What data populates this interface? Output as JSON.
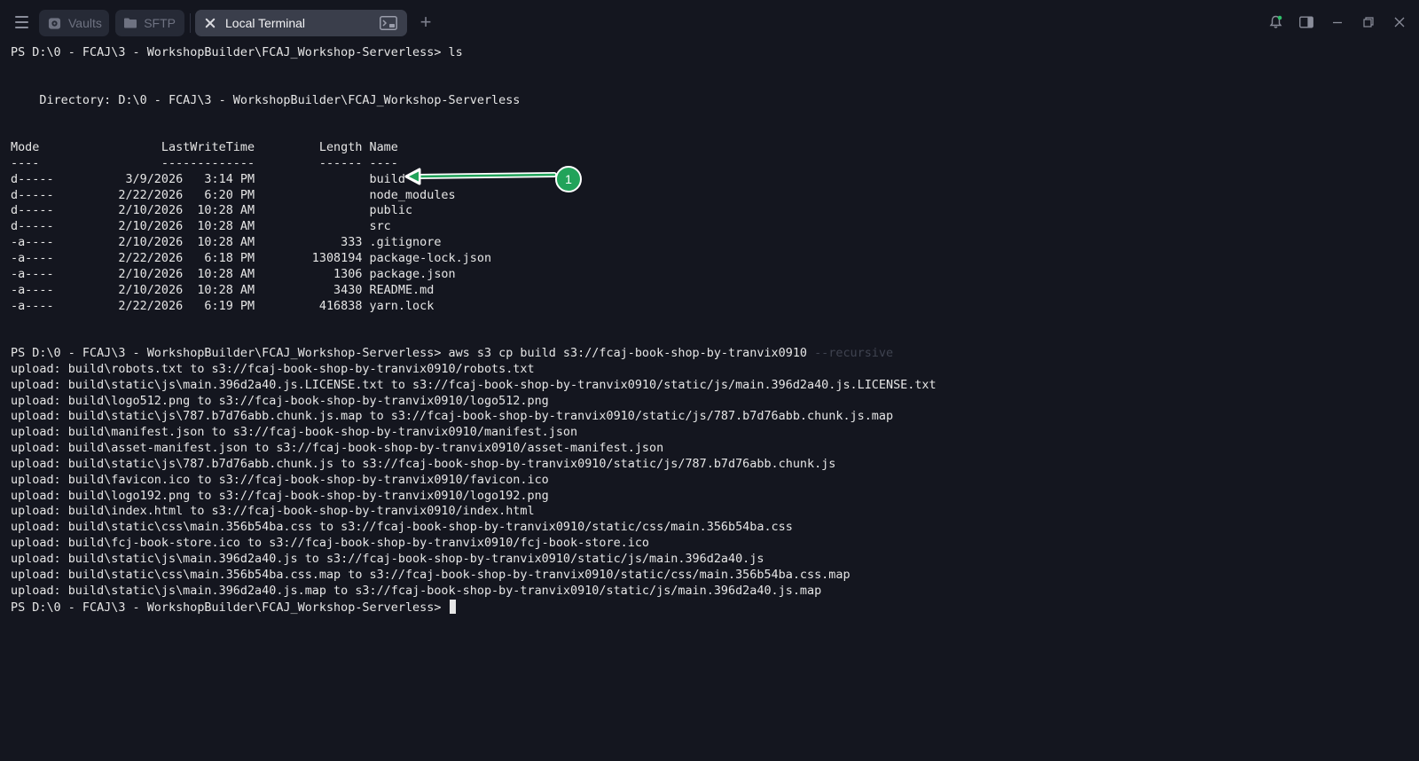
{
  "titlebar": {
    "tabs": [
      {
        "label": "Vaults",
        "icon": "vault-icon",
        "active": false
      },
      {
        "label": "SFTP",
        "icon": "folder-icon",
        "active": false
      },
      {
        "label": "Local Terminal",
        "icon": "close-icon",
        "active": true
      }
    ],
    "add_tab_label": "+",
    "window_icons": [
      "notification-bell-icon",
      "sidebar-panel-icon",
      "minimize-icon",
      "restore-icon",
      "close-icon"
    ]
  },
  "terminal": {
    "lines": [
      "PS D:\\0 - FCAJ\\3 - WorkshopBuilder\\FCAJ_Workshop-Serverless> ls",
      "",
      "",
      "    Directory: D:\\0 - FCAJ\\3 - WorkshopBuilder\\FCAJ_Workshop-Serverless",
      "",
      "",
      "Mode                 LastWriteTime         Length Name",
      "----                 -------------         ------ ----",
      "d-----          3/9/2026   3:14 PM                build",
      "d-----         2/22/2026   6:20 PM                node_modules",
      "d-----         2/10/2026  10:28 AM                public",
      "d-----         2/10/2026  10:28 AM                src",
      "-a----         2/10/2026  10:28 AM            333 .gitignore",
      "-a----         2/22/2026   6:18 PM        1308194 package-lock.json",
      "-a----         2/10/2026  10:28 AM           1306 package.json",
      "-a----         2/10/2026  10:28 AM           3430 README.md",
      "-a----         2/22/2026   6:19 PM         416838 yarn.lock",
      "",
      "",
      "PS D:\\0 - FCAJ\\3 - WorkshopBuilder\\FCAJ_Workshop-Serverless> aws s3 cp build s3://fcaj-book-shop-by-tranvix0910",
      "upload: build\\robots.txt to s3://fcaj-book-shop-by-tranvix0910/robots.txt",
      "upload: build\\static\\js\\main.396d2a40.js.LICENSE.txt to s3://fcaj-book-shop-by-tranvix0910/static/js/main.396d2a40.js.LICENSE.txt",
      "upload: build\\logo512.png to s3://fcaj-book-shop-by-tranvix0910/logo512.png",
      "upload: build\\static\\js\\787.b7d76abb.chunk.js.map to s3://fcaj-book-shop-by-tranvix0910/static/js/787.b7d76abb.chunk.js.map",
      "upload: build\\manifest.json to s3://fcaj-book-shop-by-tranvix0910/manifest.json",
      "upload: build\\asset-manifest.json to s3://fcaj-book-shop-by-tranvix0910/asset-manifest.json",
      "upload: build\\static\\js\\787.b7d76abb.chunk.js to s3://fcaj-book-shop-by-tranvix0910/static/js/787.b7d76abb.chunk.js",
      "upload: build\\favicon.ico to s3://fcaj-book-shop-by-tranvix0910/favicon.ico",
      "upload: build\\logo192.png to s3://fcaj-book-shop-by-tranvix0910/logo192.png",
      "upload: build\\index.html to s3://fcaj-book-shop-by-tranvix0910/index.html",
      "upload: build\\static\\css\\main.356b54ba.css to s3://fcaj-book-shop-by-tranvix0910/static/css/main.356b54ba.css",
      "upload: build\\fcj-book-store.ico to s3://fcaj-book-shop-by-tranvix0910/fcj-book-store.ico",
      "upload: build\\static\\js\\main.396d2a40.js to s3://fcaj-book-shop-by-tranvix0910/static/js/main.396d2a40.js",
      "upload: build\\static\\css\\main.356b54ba.css.map to s3://fcaj-book-shop-by-tranvix0910/static/css/main.356b54ba.css.map",
      "upload: build\\static\\js\\main.396d2a40.js.map to s3://fcaj-book-shop-by-tranvix0910/static/js/main.396d2a40.js.map",
      "PS D:\\0 - FCAJ\\3 - WorkshopBuilder\\FCAJ_Workshop-Serverless> "
    ],
    "dimmed_suffix": " --recursive",
    "dimmed_line_index": 19,
    "cursor_line_index": 35
  },
  "annotation": {
    "marker_label": "1",
    "color": "#21a35a"
  },
  "colors": {
    "background": "#14161f",
    "text": "#e6e6e6",
    "active_tab": "#3a3e4b",
    "inactive_tab": "#262a36"
  }
}
